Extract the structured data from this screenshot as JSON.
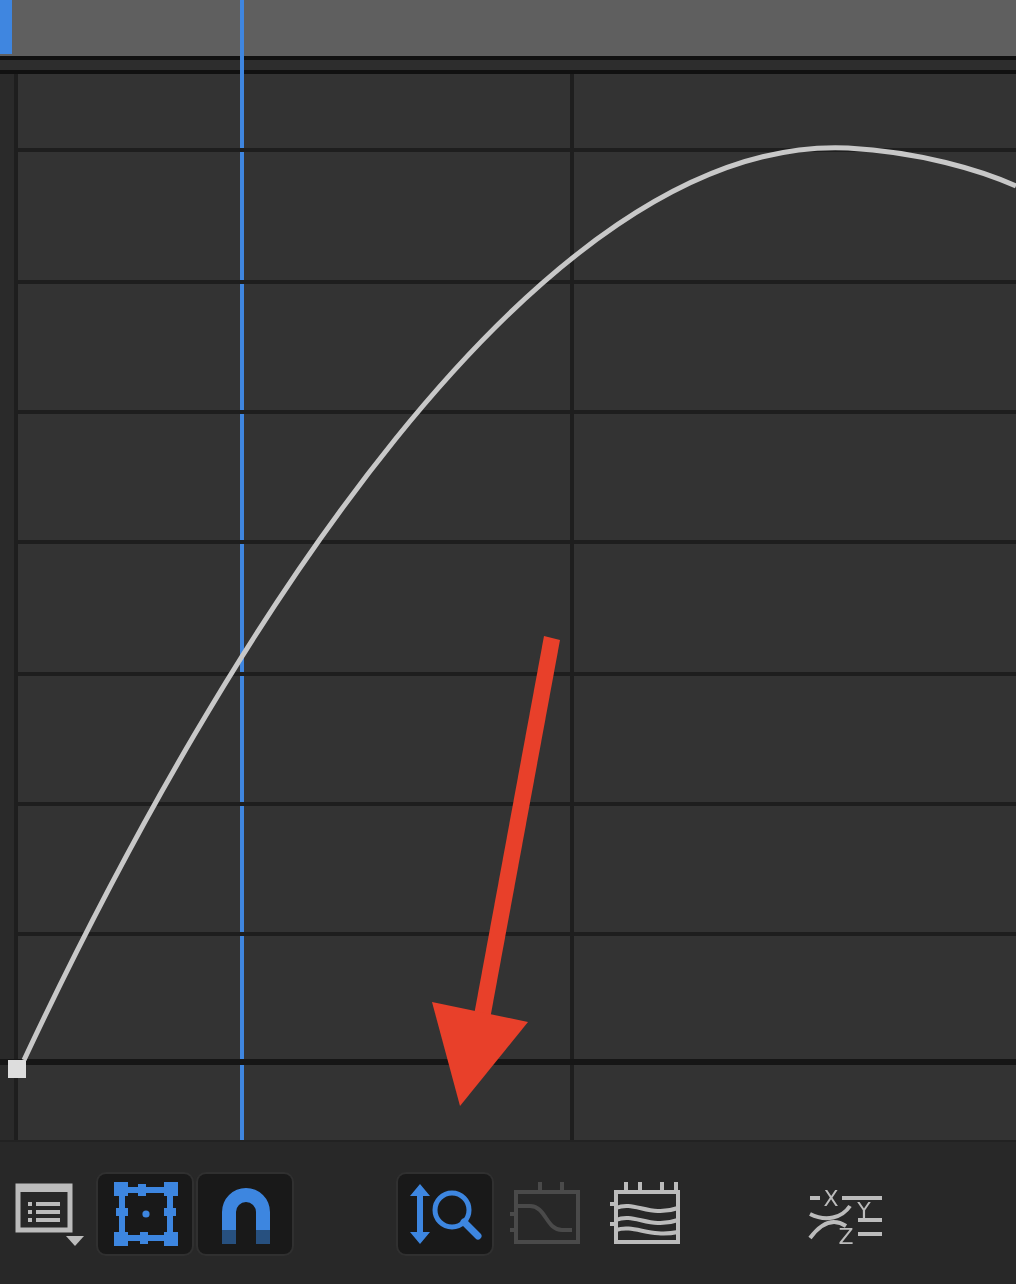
{
  "toolbar": {
    "buttons": [
      {
        "kind": "list-menu",
        "on": false,
        "disabled": false
      },
      {
        "kind": "frame",
        "on": true,
        "disabled": false
      },
      {
        "kind": "snap",
        "on": true,
        "disabled": false
      },
      {
        "kind": "zoom",
        "on": true,
        "disabled": false
      },
      {
        "kind": "wrap",
        "on": false,
        "disabled": true
      },
      {
        "kind": "normalize",
        "on": false,
        "disabled": false
      },
      {
        "kind": "axes",
        "on": false,
        "disabled": false,
        "labels": [
          "X",
          "Y",
          "Z"
        ]
      }
    ]
  }
}
